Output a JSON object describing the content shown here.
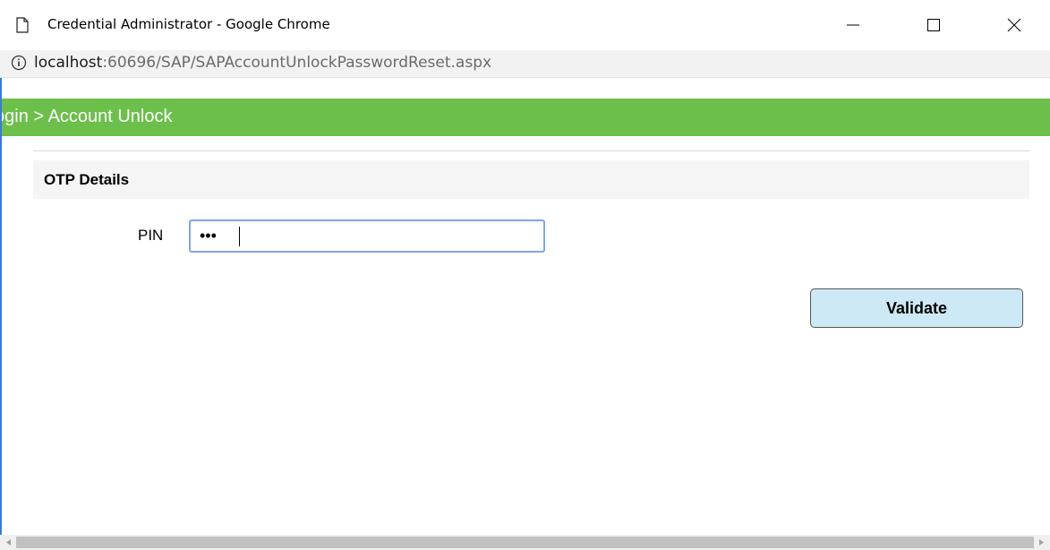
{
  "window": {
    "title": "Credential Administrator - Google Chrome",
    "page_icon": "page-icon",
    "controls": {
      "minimize_icon": "minimize-icon",
      "maximize_icon": "maximize-icon",
      "close_icon": "close-icon"
    }
  },
  "addressbar": {
    "info_icon": "info-icon",
    "host": "localhost",
    "path": ":60696/SAP/SAPAccountUnlockPasswordReset.aspx"
  },
  "page": {
    "breadcrumb": "ogin > Account Unlock",
    "section_title": "OTP Details",
    "pin_label": "PIN",
    "pin_value_masked": "•••",
    "validate_label": "Validate",
    "colors": {
      "header_green": "#6cbf4b",
      "button_bg": "#cde9f6",
      "input_focus_border": "#7fa7e6"
    }
  },
  "scrollbar": {
    "left_arrow_icon": "scroll-left-arrow-icon",
    "right_arrow_icon": "scroll-right-arrow-icon"
  }
}
